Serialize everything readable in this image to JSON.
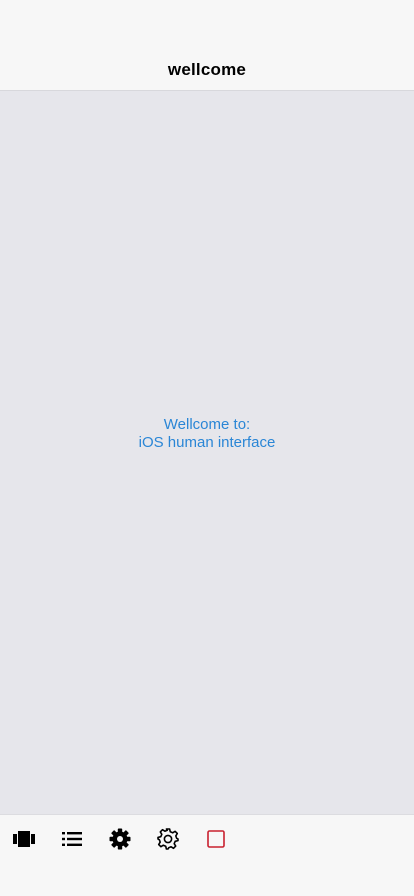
{
  "nav": {
    "title": "wellcome"
  },
  "main": {
    "welcome_line1": "Wellcome to:",
    "welcome_line2": "iOS human interface"
  },
  "tab_bar": {
    "items": [
      {
        "icon": "carousel-icon"
      },
      {
        "icon": "list-icon"
      },
      {
        "icon": "gear-filled-icon"
      },
      {
        "icon": "gear-outline-icon"
      },
      {
        "icon": "square-outline-icon"
      }
    ]
  },
  "colors": {
    "link_blue": "#2a86d6",
    "accent_red": "#c8202f",
    "bar_bg": "#f7f7f7",
    "content_bg": "#e6e6eb"
  }
}
